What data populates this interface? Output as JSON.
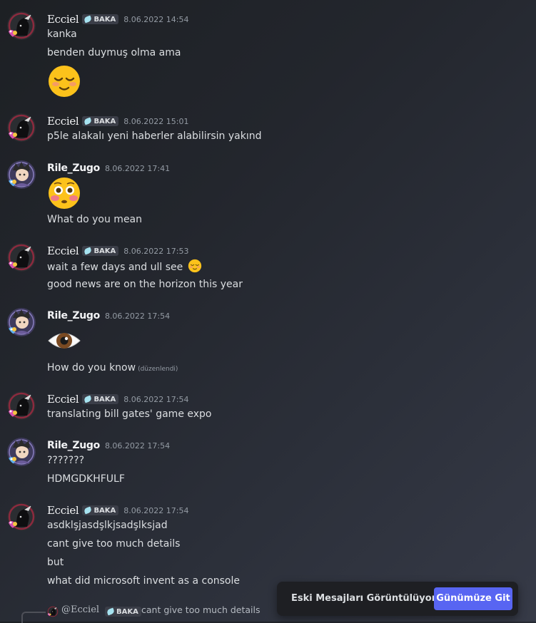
{
  "messages": [
    {
      "author": "Ecciel",
      "tag": "BAKA",
      "time": "8.06.2022 14:54",
      "lines": [
        "kanka",
        "benden duymuş olma ama"
      ],
      "emoji": "relieved-face"
    },
    {
      "author": "Ecciel",
      "tag": "BAKA",
      "time": "8.06.2022 15:01",
      "lines": [
        "p5le alakalı yeni haberler alabilirsin yakınd"
      ]
    },
    {
      "author": "Rile_Zugo",
      "time": "8.06.2022 17:41",
      "emoji": "flushed-face",
      "lines": [
        "What do you mean"
      ]
    },
    {
      "author": "Ecciel",
      "tag": "BAKA",
      "time": "8.06.2022 17:53",
      "lines": [
        "wait a few days and ull see",
        "good news are on the horizon this year"
      ],
      "inline_emoji": "relieved-face"
    },
    {
      "author": "Rile_Zugo",
      "time": "8.06.2022 17:54",
      "emoji": "eye",
      "lines": [
        "How do you know"
      ],
      "edited": "(düzenlendi)"
    },
    {
      "author": "Ecciel",
      "tag": "BAKA",
      "time": "8.06.2022 17:54",
      "lines": [
        "translating bill gates' game expo"
      ]
    },
    {
      "author": "Rile_Zugo",
      "time": "8.06.2022 17:54",
      "lines": [
        "???????",
        "HDMGDKHFULF"
      ]
    },
    {
      "author": "Ecciel",
      "tag": "BAKA",
      "time": "8.06.2022 17:54",
      "lines": [
        "asdklşjasdşlkjsadşlksjad",
        "cant give too much details",
        "but",
        "what did microsoft invent as a console"
      ]
    }
  ],
  "reply": {
    "author": "@Ecciel",
    "tag": "BAKA",
    "text": "cant give too much details"
  },
  "jump_bar": {
    "text": "Eski Mesajları Görüntülüyorsun",
    "button": "Günümüze Git",
    "button_color": "#5865f2"
  },
  "colors": {
    "ecciel_avatar_ring": "#8c2a3e",
    "rile_avatar_bg": "#3e3a5c",
    "tag_bg": "#3b3e48"
  }
}
